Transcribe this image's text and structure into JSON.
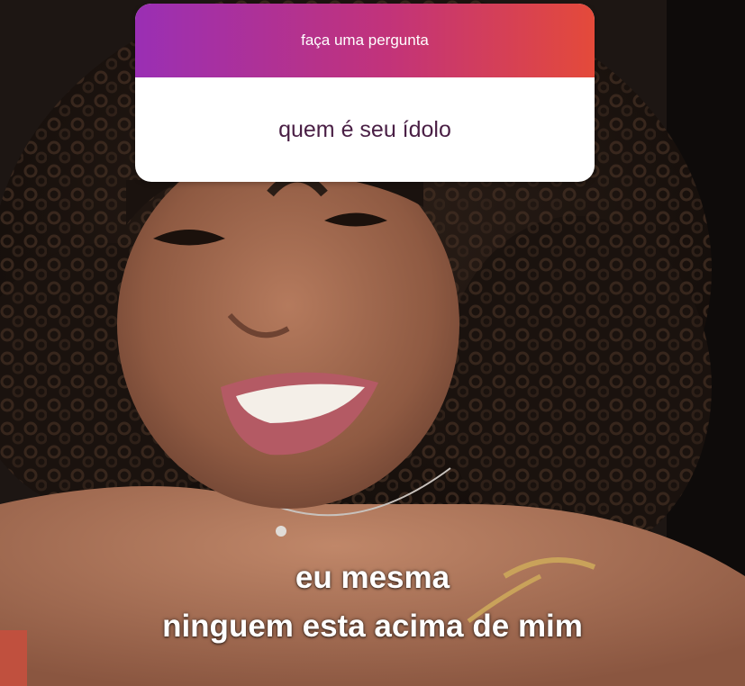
{
  "question_sticker": {
    "header": "faça uma pergunta",
    "question": "quem é seu ídolo",
    "gradient_colors": [
      "#9a2fb4",
      "#c2337a",
      "#e44a3a"
    ],
    "question_color": "#4a1f45"
  },
  "caption": {
    "line1": "eu mesma",
    "line2": "ninguem esta acima de mim"
  }
}
